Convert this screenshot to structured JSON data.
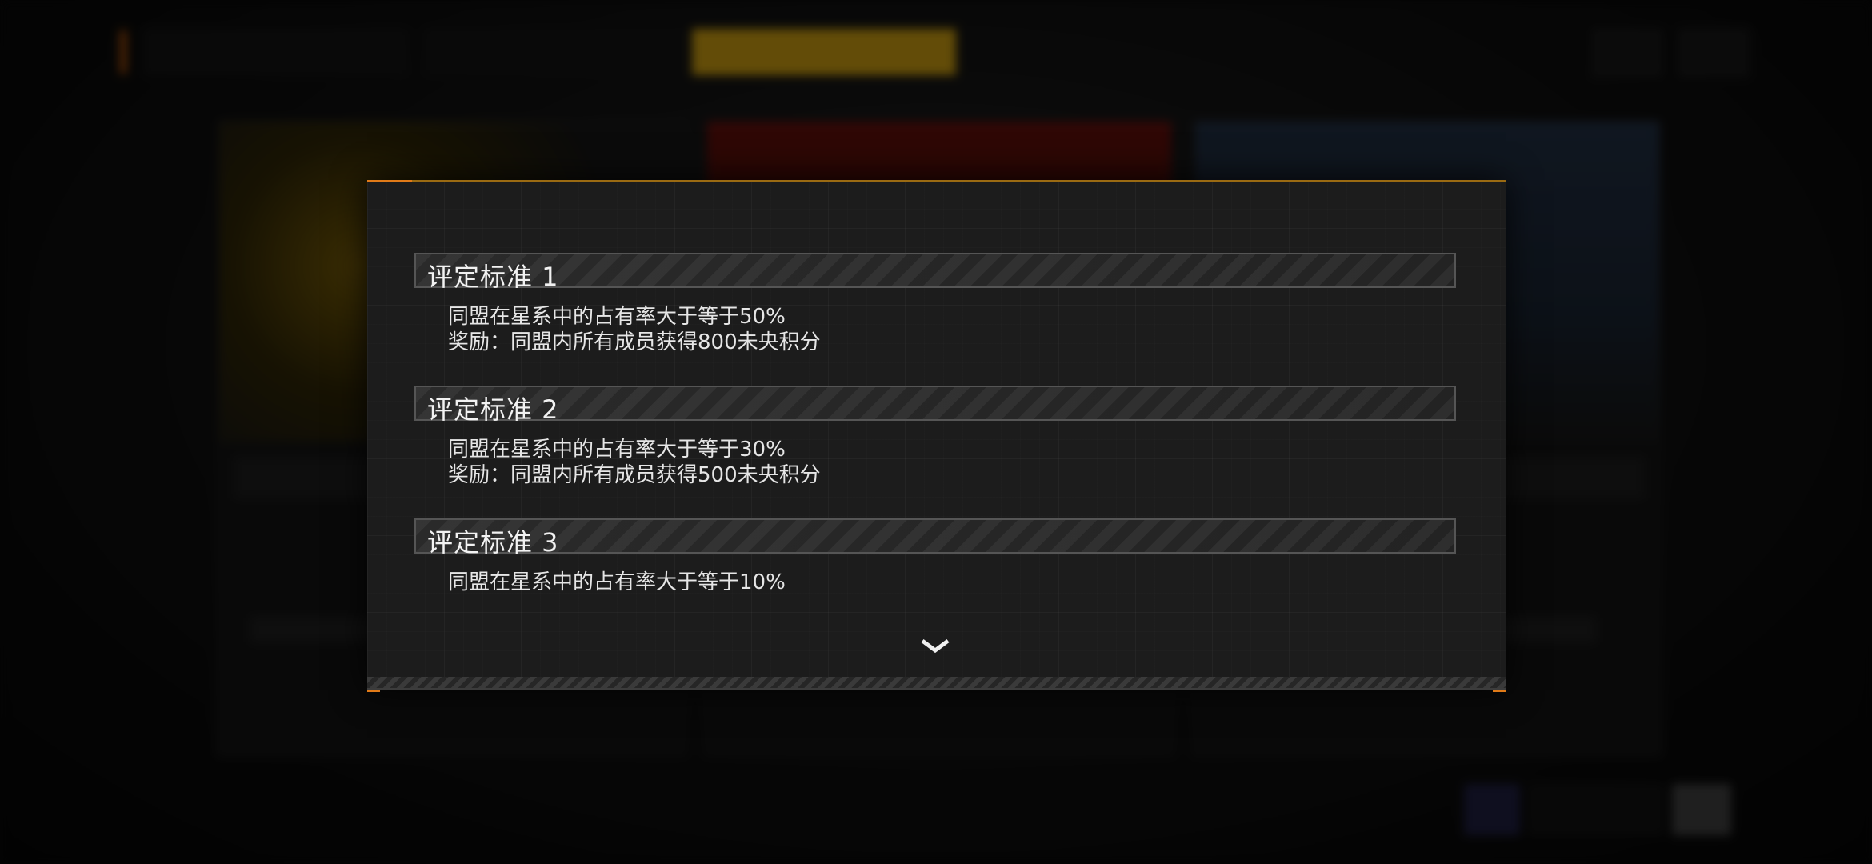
{
  "modal": {
    "criteria": [
      {
        "title": "评定标准 1",
        "condition": "同盟在星系中的占有率大于等于50%",
        "reward": "奖励：同盟内所有成员获得800未央积分"
      },
      {
        "title": "评定标准 2",
        "condition": "同盟在星系中的占有率大于等于30%",
        "reward": "奖励：同盟内所有成员获得500未央积分"
      },
      {
        "title": "评定标准 3",
        "condition": "同盟在星系中的占有率大于等于10%",
        "reward": ""
      }
    ],
    "scroll_indicator_icon": "chevron-down-icon"
  },
  "colors": {
    "accent_orange": "#e07a18",
    "accent_gold": "#9a6a12",
    "background_tab_active": "#b48b0f"
  }
}
